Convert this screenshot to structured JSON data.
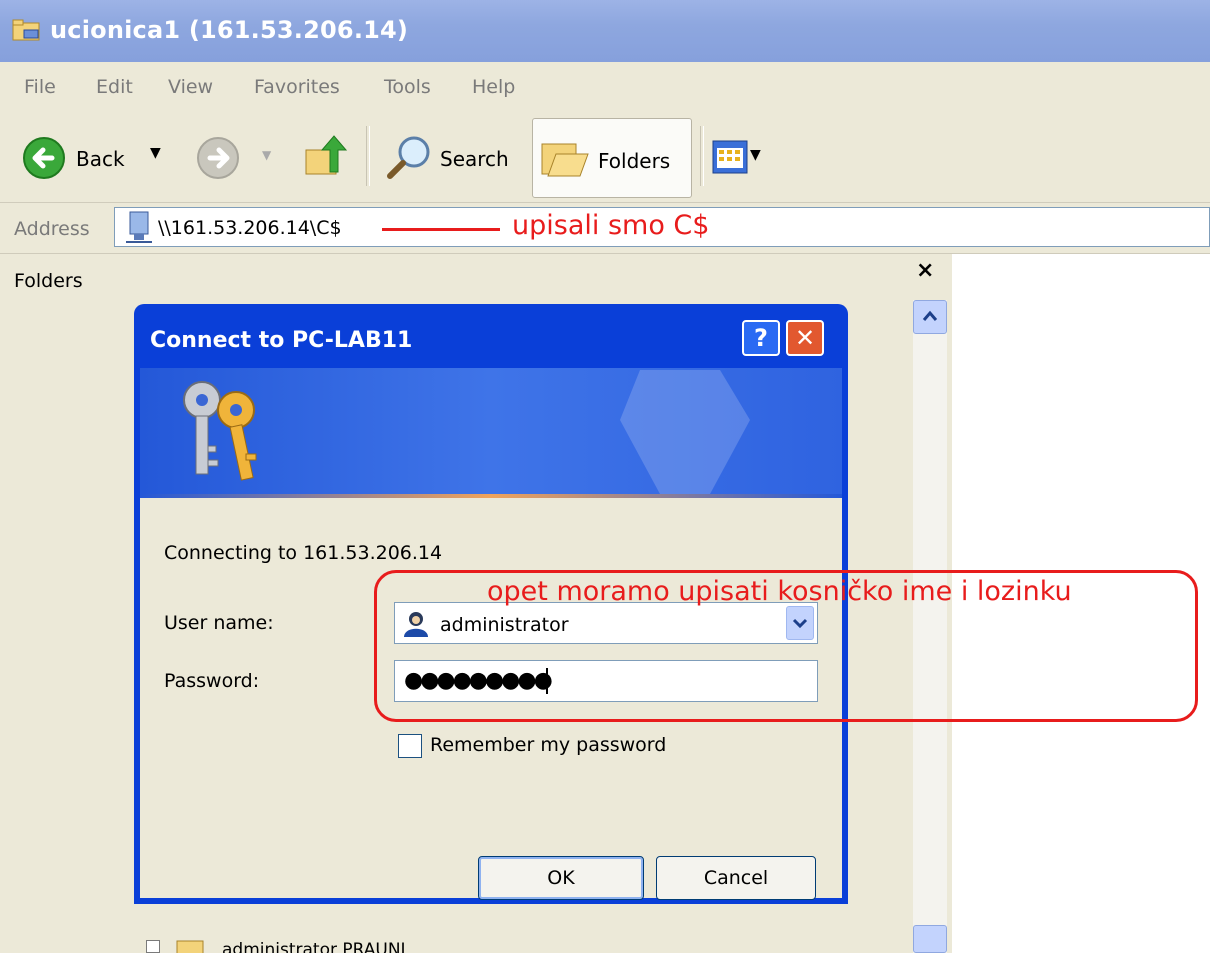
{
  "window": {
    "title": "ucionica1 (161.53.206.14)",
    "menu": [
      "File",
      "Edit",
      "View",
      "Favorites",
      "Tools",
      "Help"
    ],
    "toolbar": {
      "back_label": "Back",
      "search_label": "Search",
      "folders_label": "Folders"
    },
    "address": {
      "label": "Address",
      "value": "\\\\161.53.206.14\\C$"
    },
    "folders_pane": {
      "title": "Folders",
      "close": "×",
      "tree_item": "administrator PRAUNI"
    }
  },
  "dialog": {
    "title": "Connect to PC-LAB11",
    "help": "?",
    "close": "✕",
    "connecting_text": "Connecting to 161.53.206.14",
    "username_label": "User name:",
    "username_value": "administrator",
    "password_label": "Password:",
    "password_value": "●●●●●●●●●",
    "remember_label": "Remember my password",
    "ok_label": "OK",
    "cancel_label": "Cancel"
  },
  "annotations": {
    "first": "upisali smo C$",
    "second": "opet moramo upisati kosničko ime i lozinku"
  },
  "colors": {
    "annotation": "#e81c1c",
    "dialog_frame": "#0a3fd8",
    "title_bar": "#8ea7df"
  }
}
